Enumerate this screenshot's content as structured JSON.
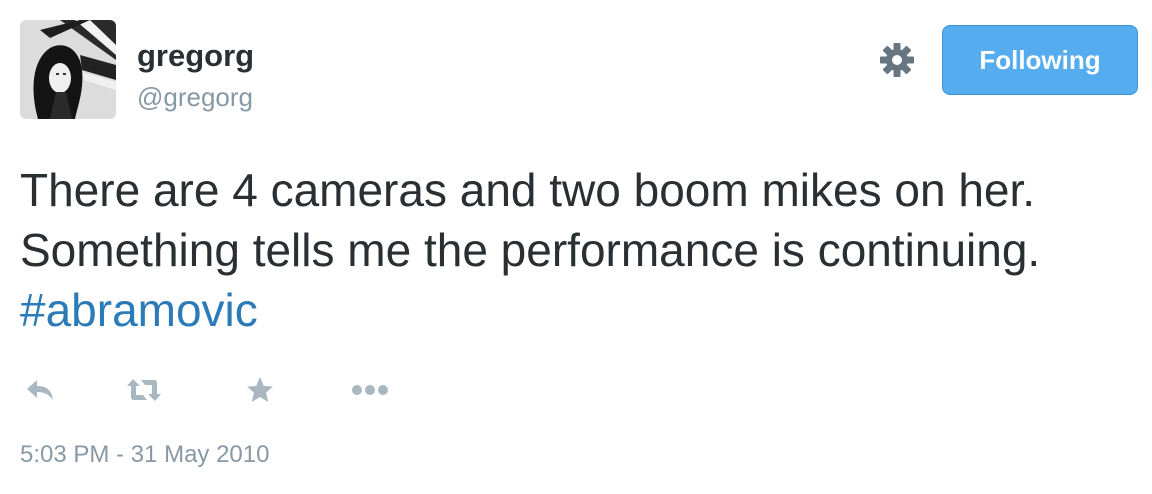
{
  "user": {
    "display_name": "gregorg",
    "screen_name": "@gregorg",
    "avatar_icon": "profile-photo"
  },
  "header": {
    "settings_icon": "gear-icon",
    "follow_button_label": "Following"
  },
  "tweet": {
    "text": "There are 4 cameras and two boom mikes on her. Something tells me the performance is continuing.",
    "hashtag": "#abramovic",
    "timestamp": "5:03 PM - 31 May 2010"
  },
  "actions": [
    {
      "name": "reply-icon"
    },
    {
      "name": "retweet-icon"
    },
    {
      "name": "favorite-icon"
    },
    {
      "name": "more-icon"
    }
  ],
  "colors": {
    "primary_text": "#292f33",
    "secondary_text": "#8899a6",
    "link": "#2b7bb9",
    "button_bg": "#55acee",
    "icon_gray": "#a9b7c1",
    "gear": "#66757f"
  }
}
